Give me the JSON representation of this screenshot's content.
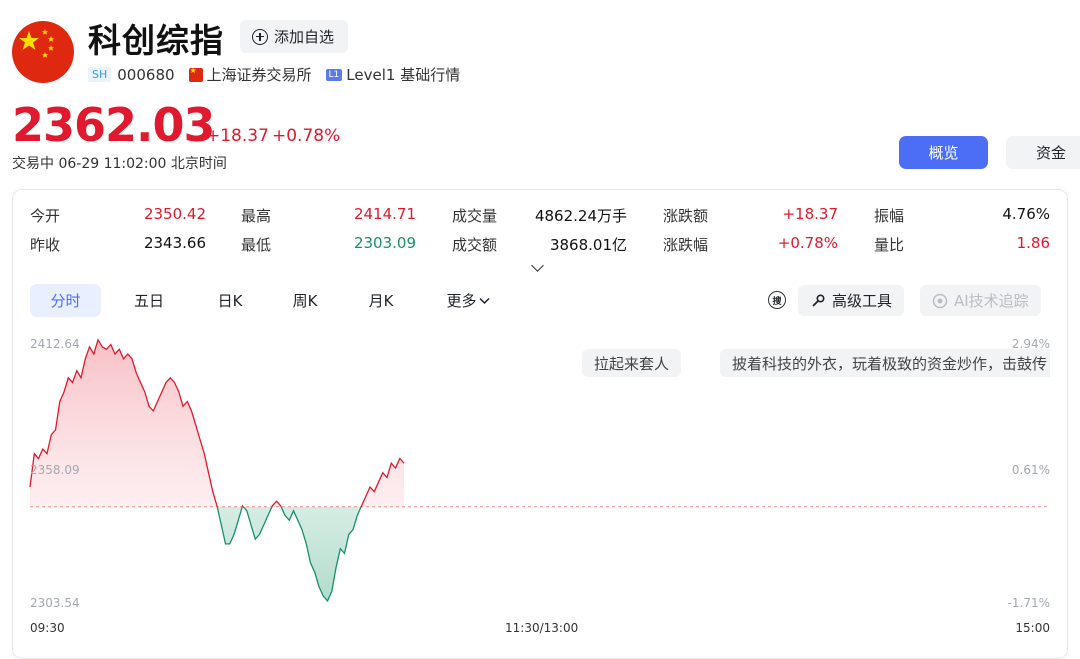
{
  "header": {
    "title": "科创综指",
    "add_label": "添加自选",
    "exchange_tag": "SH",
    "code": "000680",
    "exchange": "上海证券交易所",
    "level_tag": "L1",
    "level": "Level1 基础行情"
  },
  "quote": {
    "price": "2362.03",
    "change": "+18.37",
    "change_pct": "+0.78%",
    "status": "交易中 06-29 11:02:00 北京时间"
  },
  "view_tabs": [
    "概览",
    "资金"
  ],
  "stats": [
    {
      "label": "今开",
      "value": "2350.42"
    },
    {
      "label": "昨收",
      "value": "2343.66"
    },
    {
      "label": "最高",
      "value": "2414.71"
    },
    {
      "label": "最低",
      "value": "2303.09"
    },
    {
      "label": "成交量",
      "value": "4862.24万手"
    },
    {
      "label": "成交额",
      "value": "3868.01亿"
    },
    {
      "label": "涨跌额",
      "value": "+18.37"
    },
    {
      "label": "涨跌幅",
      "value": "+0.78%"
    },
    {
      "label": "振幅",
      "value": "4.76%"
    },
    {
      "label": "量比",
      "value": "1.86"
    }
  ],
  "chart_tabs": [
    "分时",
    "五日",
    "日K",
    "周K",
    "月K",
    "更多"
  ],
  "tools": {
    "replay_icon": "搜",
    "advanced": "高级工具",
    "ai": "AI技术追踪"
  },
  "danmaku": [
    "拉起来套人",
    "披着科技的外衣，玩着极致的资金炒作，击鼓传"
  ],
  "colors": {
    "up": "#e0192f",
    "down": "#1a8f6a",
    "accent": "#4c6ef5"
  },
  "chart_data": {
    "type": "line",
    "y_labels_left": [
      "2412.64",
      "2358.09",
      "2303.54"
    ],
    "y_labels_right": [
      "2.94%",
      "0.61%",
      "-1.71%"
    ],
    "x_labels": [
      "09:30",
      "11:30/13:00",
      "15:00"
    ],
    "prev_close": 2343.66,
    "ylim": [
      2303.54,
      2412.64
    ],
    "session_points": 240,
    "series": [
      {
        "values": [
          2352,
          2366,
          2364,
          2368,
          2366,
          2374,
          2376,
          2388,
          2392,
          2398,
          2396,
          2401,
          2398,
          2406,
          2411,
          2408,
          2414,
          2411,
          2410,
          2412,
          2408,
          2410,
          2406,
          2408,
          2406,
          2400,
          2396,
          2392,
          2386,
          2384,
          2388,
          2392,
          2396,
          2398,
          2396,
          2392,
          2386,
          2388,
          2384,
          2378,
          2372,
          2366,
          2358,
          2350,
          2344,
          2336,
          2328,
          2328,
          2332,
          2338,
          2344,
          2342,
          2336,
          2330,
          2332,
          2336,
          2340,
          2344,
          2346,
          2344,
          2340,
          2338,
          2342,
          2338,
          2334,
          2328,
          2320,
          2316,
          2310,
          2306,
          2304,
          2308,
          2318,
          2326,
          2324,
          2332,
          2334,
          2340,
          2344,
          2348,
          2352,
          2350,
          2354,
          2358,
          2356,
          2362,
          2360,
          2364,
          2362
        ]
      }
    ]
  }
}
